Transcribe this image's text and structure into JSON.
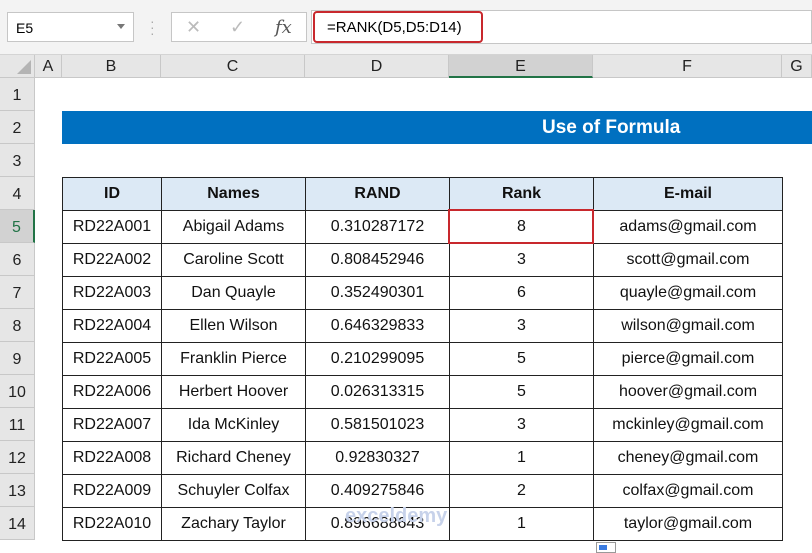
{
  "formula_bar": {
    "name_box": "E5",
    "cancel_icon": "✕",
    "enter_icon": "✓",
    "fx_label": "fx",
    "formula": "=RANK(D5,D5:D14)"
  },
  "columns": [
    "A",
    "B",
    "C",
    "D",
    "E",
    "F",
    "G"
  ],
  "rows": [
    "1",
    "2",
    "3",
    "4",
    "5",
    "6",
    "7",
    "8",
    "9",
    "10",
    "11",
    "12",
    "13",
    "14"
  ],
  "title": "Use of Formula",
  "table": {
    "headers": [
      "ID",
      "Names",
      "RAND",
      "Rank",
      "E-mail"
    ],
    "rows": [
      [
        "RD22A001",
        "Abigail Adams",
        "0.310287172",
        "8",
        "adams@gmail.com"
      ],
      [
        "RD22A002",
        "Caroline Scott",
        "0.808452946",
        "3",
        "scott@gmail.com"
      ],
      [
        "RD22A003",
        "Dan Quayle",
        "0.352490301",
        "6",
        "quayle@gmail.com"
      ],
      [
        "RD22A004",
        "Ellen Wilson",
        "0.646329833",
        "3",
        "wilson@gmail.com"
      ],
      [
        "RD22A005",
        "Franklin Pierce",
        "0.210299095",
        "5",
        "pierce@gmail.com"
      ],
      [
        "RD22A006",
        "Herbert Hoover",
        "0.026313315",
        "5",
        "hoover@gmail.com"
      ],
      [
        "RD22A007",
        "Ida McKinley",
        "0.581501023",
        "3",
        "mckinley@gmail.com"
      ],
      [
        "RD22A008",
        "Richard Cheney",
        "0.92830327",
        "1",
        "cheney@gmail.com"
      ],
      [
        "RD22A009",
        "Schuyler Colfax",
        "0.409275846",
        "2",
        "colfax@gmail.com"
      ],
      [
        "RD22A010",
        "Zachary Taylor",
        "0.896688643",
        "1",
        "taylor@gmail.com"
      ]
    ]
  },
  "watermark": "exceldemy",
  "colors": {
    "title_bg": "#0070c0",
    "header_bg": "#dce9f5",
    "highlight": "#c8282d",
    "selection": "#217346"
  }
}
